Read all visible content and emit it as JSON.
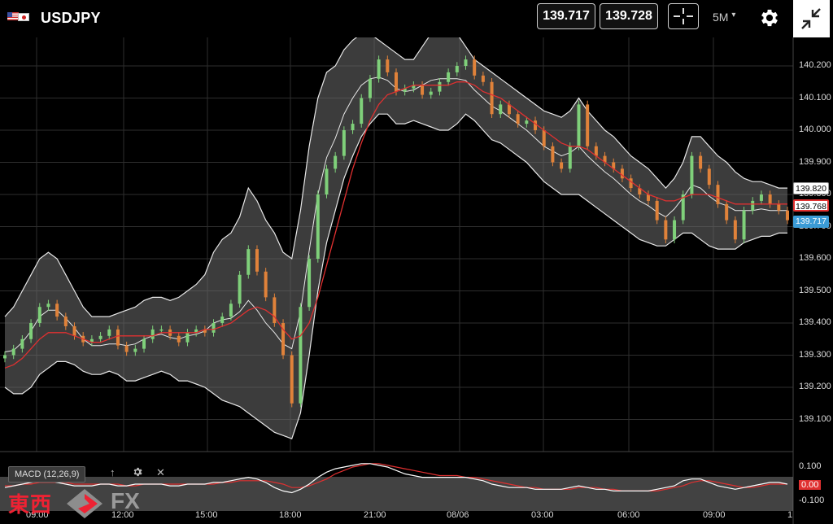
{
  "header": {
    "symbol": "USDJPY",
    "bid": "139.717",
    "ask": "139.728",
    "timeframe": "5M",
    "timeframe_caret": "▾"
  },
  "price_axis": [
    "140.200",
    "140.100",
    "140.000",
    "139.900",
    "139.800",
    "139.700",
    "139.600",
    "139.500",
    "139.400",
    "139.300",
    "139.200",
    "139.100"
  ],
  "price_tags": {
    "upper_band": "139.820",
    "ma": "139.768",
    "last": "139.717",
    "last_color": "#3b9bd6",
    "ma_color": "#e03030"
  },
  "time_axis": [
    "09:00",
    "12:00",
    "15:00",
    "18:00",
    "21:00",
    "08/06",
    "03:00",
    "06:00",
    "09:00",
    "1"
  ],
  "macd": {
    "label": "MACD (12,26,9)",
    "axis": [
      "0.100",
      "0.00",
      "-0.100"
    ],
    "up_icon": "↑",
    "close_icon": "✕"
  },
  "watermark": {
    "kanji": "東西",
    "fx": "FX"
  },
  "chart_data": {
    "type": "candlestick",
    "symbol": "USDJPY",
    "interval": "5M",
    "ylim": [
      139.05,
      140.3
    ],
    "x": [
      "09:00",
      "12:00",
      "15:00",
      "18:00",
      "21:00",
      "08/06",
      "03:00",
      "06:00",
      "09:00"
    ],
    "close": [
      139.3,
      139.32,
      139.35,
      139.4,
      139.45,
      139.46,
      139.42,
      139.39,
      139.36,
      139.34,
      139.35,
      139.36,
      139.38,
      139.33,
      139.31,
      139.32,
      139.35,
      139.38,
      139.38,
      139.36,
      139.34,
      139.37,
      139.38,
      139.37,
      139.4,
      139.42,
      139.46,
      139.55,
      139.63,
      139.56,
      139.48,
      139.4,
      139.3,
      139.15,
      139.45,
      139.6,
      139.8,
      139.88,
      139.92,
      140.0,
      140.02,
      140.1,
      140.16,
      140.22,
      140.18,
      140.12,
      140.13,
      140.14,
      140.11,
      140.12,
      140.15,
      140.18,
      140.2,
      140.22,
      140.17,
      140.15,
      140.05,
      140.08,
      140.05,
      140.02,
      140.03,
      140.0,
      139.95,
      139.9,
      139.88,
      139.95,
      140.08,
      139.95,
      139.92,
      139.9,
      139.88,
      139.85,
      139.82,
      139.8,
      139.78,
      139.72,
      139.66,
      139.72,
      139.8,
      139.92,
      139.88,
      139.83,
      139.77,
      139.72,
      139.66,
      139.75,
      139.78,
      139.8,
      139.77,
      139.75,
      139.72
    ],
    "ma": [
      139.26,
      139.27,
      139.29,
      139.32,
      139.35,
      139.37,
      139.37,
      139.37,
      139.36,
      139.35,
      139.34,
      139.34,
      139.35,
      139.36,
      139.36,
      139.36,
      139.36,
      139.36,
      139.37,
      139.37,
      139.37,
      139.37,
      139.37,
      139.38,
      139.38,
      139.39,
      139.4,
      139.42,
      139.44,
      139.45,
      139.44,
      139.42,
      139.38,
      139.35,
      139.36,
      139.4,
      139.48,
      139.58,
      139.68,
      139.78,
      139.88,
      139.96,
      140.03,
      140.08,
      140.11,
      140.12,
      140.13,
      140.14,
      140.14,
      140.14,
      140.14,
      140.14,
      140.15,
      140.15,
      140.14,
      140.12,
      140.11,
      140.1,
      140.08,
      140.06,
      140.04,
      140.02,
      140.0,
      139.98,
      139.96,
      139.95,
      139.95,
      139.94,
      139.92,
      139.9,
      139.88,
      139.86,
      139.84,
      139.82,
      139.8,
      139.79,
      139.78,
      139.78,
      139.79,
      139.8,
      139.8,
      139.8,
      139.79,
      139.78,
      139.77,
      139.77,
      139.77,
      139.77,
      139.77,
      139.77,
      139.77
    ],
    "bb_upper": [
      139.42,
      139.45,
      139.5,
      139.55,
      139.6,
      139.62,
      139.6,
      139.55,
      139.5,
      139.45,
      139.42,
      139.42,
      139.42,
      139.43,
      139.44,
      139.45,
      139.47,
      139.48,
      139.48,
      139.47,
      139.48,
      139.5,
      139.52,
      139.55,
      139.62,
      139.66,
      139.68,
      139.73,
      139.82,
      139.78,
      139.72,
      139.68,
      139.62,
      139.6,
      139.75,
      139.95,
      140.1,
      140.18,
      140.2,
      140.25,
      140.28,
      140.3,
      140.3,
      140.28,
      140.26,
      140.24,
      140.22,
      140.22,
      140.26,
      140.3,
      140.32,
      140.32,
      140.3,
      140.26,
      140.22,
      140.2,
      140.18,
      140.16,
      140.14,
      140.12,
      140.1,
      140.08,
      140.06,
      140.05,
      140.04,
      140.06,
      140.1,
      140.06,
      140.03,
      140.0,
      139.98,
      139.95,
      139.92,
      139.9,
      139.88,
      139.85,
      139.82,
      139.85,
      139.9,
      139.98,
      139.98,
      139.95,
      139.92,
      139.9,
      139.87,
      139.85,
      139.84,
      139.84,
      139.83,
      139.82,
      139.82
    ],
    "bb_lower": [
      139.2,
      139.18,
      139.18,
      139.2,
      139.24,
      139.26,
      139.28,
      139.28,
      139.27,
      139.25,
      139.24,
      139.24,
      139.25,
      139.24,
      139.22,
      139.22,
      139.23,
      139.24,
      139.25,
      139.24,
      139.22,
      139.22,
      139.21,
      139.2,
      139.18,
      139.16,
      139.15,
      139.14,
      139.12,
      139.1,
      139.08,
      139.06,
      139.05,
      139.04,
      139.12,
      139.3,
      139.5,
      139.65,
      139.75,
      139.85,
      139.92,
      139.98,
      140.02,
      140.05,
      140.05,
      140.02,
      140.02,
      140.03,
      140.02,
      140.01,
      140.0,
      140.0,
      140.02,
      140.05,
      140.03,
      140.0,
      139.97,
      139.96,
      139.94,
      139.92,
      139.9,
      139.87,
      139.84,
      139.82,
      139.8,
      139.8,
      139.8,
      139.78,
      139.76,
      139.74,
      139.72,
      139.7,
      139.68,
      139.66,
      139.65,
      139.64,
      139.64,
      139.66,
      139.68,
      139.68,
      139.66,
      139.64,
      139.63,
      139.63,
      139.63,
      139.65,
      139.66,
      139.67,
      139.67,
      139.68,
      139.68
    ],
    "macd_line": [
      -0.02,
      -0.01,
      0.0,
      0.01,
      0.02,
      0.02,
      0.01,
      0.0,
      -0.01,
      -0.01,
      -0.01,
      0.0,
      0.0,
      -0.01,
      -0.01,
      0.0,
      0.0,
      0.0,
      0.0,
      -0.01,
      -0.01,
      0.0,
      0.0,
      0.0,
      0.01,
      0.01,
      0.02,
      0.03,
      0.04,
      0.03,
      0.01,
      -0.02,
      -0.04,
      -0.05,
      -0.03,
      0.0,
      0.04,
      0.07,
      0.09,
      0.1,
      0.11,
      0.12,
      0.12,
      0.11,
      0.1,
      0.08,
      0.06,
      0.05,
      0.04,
      0.04,
      0.04,
      0.04,
      0.04,
      0.04,
      0.03,
      0.02,
      0.0,
      -0.01,
      -0.02,
      -0.02,
      -0.02,
      -0.03,
      -0.03,
      -0.03,
      -0.03,
      -0.02,
      -0.01,
      -0.02,
      -0.03,
      -0.03,
      -0.04,
      -0.04,
      -0.04,
      -0.04,
      -0.04,
      -0.03,
      -0.02,
      -0.01,
      0.02,
      0.03,
      0.03,
      0.01,
      -0.01,
      -0.02,
      -0.03,
      -0.02,
      -0.01,
      0.0,
      0.01,
      0.01,
      0.0
    ],
    "macd_signal": [
      -0.01,
      -0.01,
      0.0,
      0.0,
      0.01,
      0.01,
      0.01,
      0.01,
      0.0,
      0.0,
      0.0,
      0.0,
      0.0,
      0.0,
      -0.01,
      -0.01,
      0.0,
      0.0,
      0.0,
      0.0,
      0.0,
      0.0,
      0.0,
      0.0,
      0.0,
      0.01,
      0.01,
      0.02,
      0.02,
      0.02,
      0.02,
      0.01,
      0.0,
      -0.02,
      -0.02,
      -0.01,
      0.01,
      0.03,
      0.06,
      0.08,
      0.1,
      0.11,
      0.12,
      0.12,
      0.11,
      0.1,
      0.09,
      0.08,
      0.07,
      0.06,
      0.05,
      0.05,
      0.05,
      0.04,
      0.04,
      0.03,
      0.02,
      0.01,
      0.0,
      -0.01,
      -0.02,
      -0.02,
      -0.03,
      -0.03,
      -0.03,
      -0.03,
      -0.02,
      -0.02,
      -0.02,
      -0.03,
      -0.03,
      -0.04,
      -0.04,
      -0.04,
      -0.04,
      -0.04,
      -0.03,
      -0.02,
      -0.01,
      0.01,
      0.02,
      0.02,
      0.01,
      0.0,
      -0.01,
      -0.02,
      -0.02,
      -0.01,
      0.0,
      0.0,
      0.0
    ]
  }
}
